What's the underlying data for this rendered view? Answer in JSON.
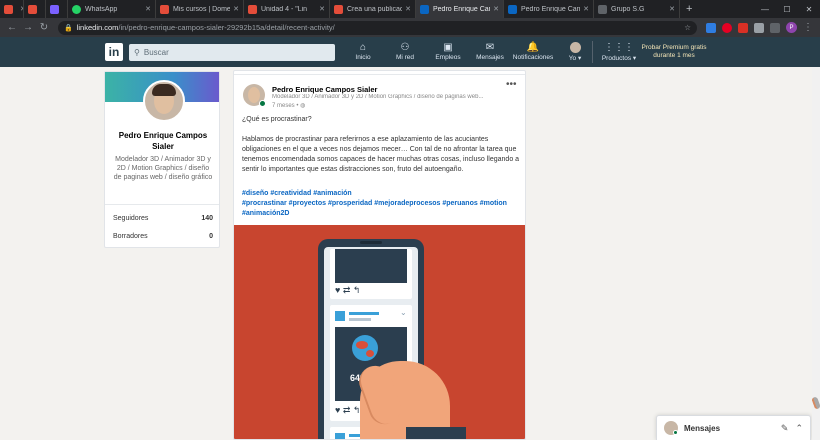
{
  "browser": {
    "tabs": [
      {
        "label": "",
        "color": "#e44d3a"
      },
      {
        "label": "",
        "color": "#e44d3a"
      },
      {
        "label": "",
        "color": "#7b61ff"
      },
      {
        "label": "WhatsApp",
        "color": "#25d366"
      },
      {
        "label": "Mis cursos | Domes",
        "color": "#e44d3a"
      },
      {
        "label": "Unidad 4 - \"Lin",
        "color": "#e44d3a"
      },
      {
        "label": "Crea una publicació",
        "color": "#e44d3a"
      },
      {
        "label": "Pedro Enrique Camp",
        "color": "#0a66c2"
      },
      {
        "label": "Pedro Enrique Camp",
        "color": "#0a66c2"
      },
      {
        "label": "Grupo S.G",
        "color": "#5f6368"
      }
    ],
    "url_host": "linkedin.com",
    "url_path": "/in/pedro-enrique-campos-sialer-29292b15a/detail/recent-activity/",
    "profile_initial": "P"
  },
  "linkedin_nav": {
    "logo": "in",
    "search_placeholder": "Buscar",
    "items": [
      {
        "label": "Inicio",
        "icon": "home-icon",
        "glyph": "⌂"
      },
      {
        "label": "Mi red",
        "icon": "network-icon",
        "glyph": "👥"
      },
      {
        "label": "Empleos",
        "icon": "jobs-icon",
        "glyph": "▣"
      },
      {
        "label": "Mensajes",
        "icon": "messages-icon",
        "glyph": "✉"
      },
      {
        "label": "Notificaciones",
        "icon": "bell-icon",
        "glyph": "🔔"
      },
      {
        "label": "Yo ▾",
        "icon": "me-avatar",
        "glyph": "●"
      },
      {
        "label": "Productos ▾",
        "icon": "grid-icon",
        "glyph": "⋮⋮"
      }
    ],
    "premium": "Probar Premium gratis durante 1 mes"
  },
  "profile_card": {
    "name": "Pedro Enrique Campos Sialer",
    "headline": "Modelador 3D / Animador 3D y 2D / Motion Graphics / diseño de paginas web / diseño gráfico",
    "stats": [
      {
        "label": "Seguidores",
        "value": "140"
      },
      {
        "label": "Borradores",
        "value": "0"
      }
    ]
  },
  "post": {
    "author": "Pedro Enrique Campos Sialer",
    "subtitle": "Modelador 3D / Animador 3D y 2D / Motion Graphics / diseño de paginas web...",
    "time": "7 meses • ",
    "question": "¿Qué es procrastinar?",
    "body": "Hablamos de procrastinar para referirnos a ese aplazamiento de las acuciantes obligaciones en el que a veces nos dejamos mecer… Con tal de no afrontar la tarea que tenemos encomendada somos capaces de hacer muchas otras cosas, incluso llegando a sentir lo importantes que estas distracciones son, fruto del autoengaño.",
    "tags_line1": "#diseño #creatividad #animación",
    "tags_line2": "#procrastinar #proyectos #prosperidad #mejoradeprocesos #peruanos #motion #animación2D",
    "illustration_percent": "64%"
  },
  "messaging": {
    "title": "Mensajes"
  }
}
